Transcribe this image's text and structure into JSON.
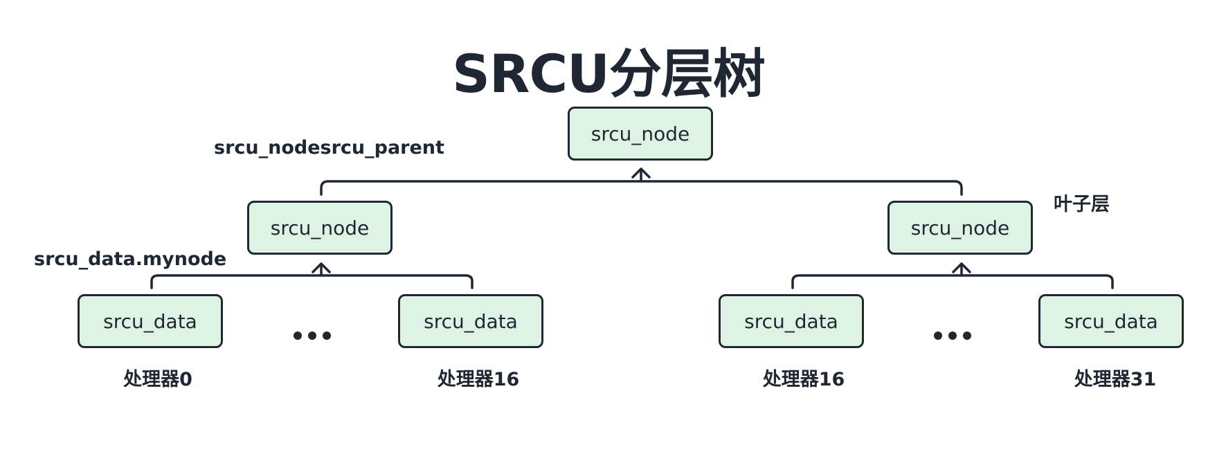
{
  "title": "SRCU分层树",
  "root_node": "srcu_node",
  "left_node": "srcu_node",
  "right_node": "srcu_node",
  "leaf_nodes": [
    "srcu_data",
    "srcu_data",
    "srcu_data",
    "srcu_data"
  ],
  "ellipsis": "...",
  "labels": {
    "parent_pointer": "srcu_nodesrcu_parent",
    "mynode_pointer": "srcu_data.mynode",
    "leaf_layer": "叶子层"
  },
  "cpus": [
    "处理器0",
    "处理器16",
    "处理器16",
    "处理器31"
  ],
  "colors": {
    "node_fill": "#dff3e4",
    "stroke": "#1f2733"
  }
}
